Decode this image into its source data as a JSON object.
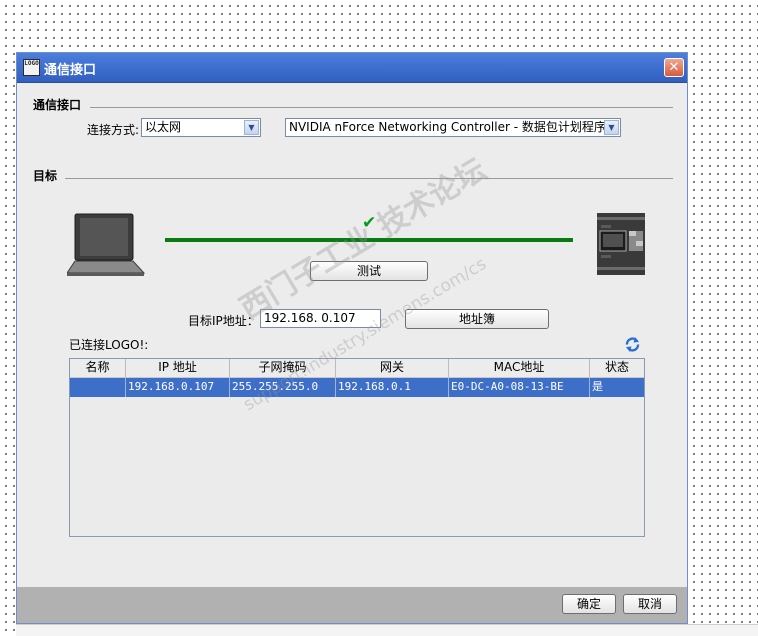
{
  "window": {
    "title": "通信接口",
    "app_icon_text": "LOGO",
    "close_glyph": "✕"
  },
  "interface_section": {
    "title": "通信接口",
    "connection_label": "连接方式:",
    "connection_value": "以太网",
    "adapter_value": "NVIDIA nForce Networking Controller - 数据包计划程序..."
  },
  "target_section": {
    "title": "目标",
    "status_check": "✔",
    "test_button": "测试",
    "ip_label": "目标IP地址：",
    "ip_value": "192.168. 0.107",
    "address_book_button": "地址簿",
    "connected_label": "已连接LOGO!:",
    "refresh_icon": "refresh-icon"
  },
  "table": {
    "columns": [
      "名称",
      "IP 地址",
      "子网掩码",
      "网关",
      "MAC地址",
      "状态"
    ],
    "rows": [
      [
        "",
        "192.168.0.107",
        "255.255.255.0",
        "192.168.0.1",
        "E0-DC-A0-08-13-BE",
        "是"
      ]
    ]
  },
  "footer": {
    "ok_button": "确定",
    "cancel_button": "取消"
  },
  "watermark": {
    "line1": "西门子工业  技术论坛",
    "line2": "support.industry.siemens.com/cs"
  },
  "colors": {
    "title_bar": "#3f6fd0",
    "link_line": "#0a7a12",
    "selected_row": "#3d6fc9"
  }
}
